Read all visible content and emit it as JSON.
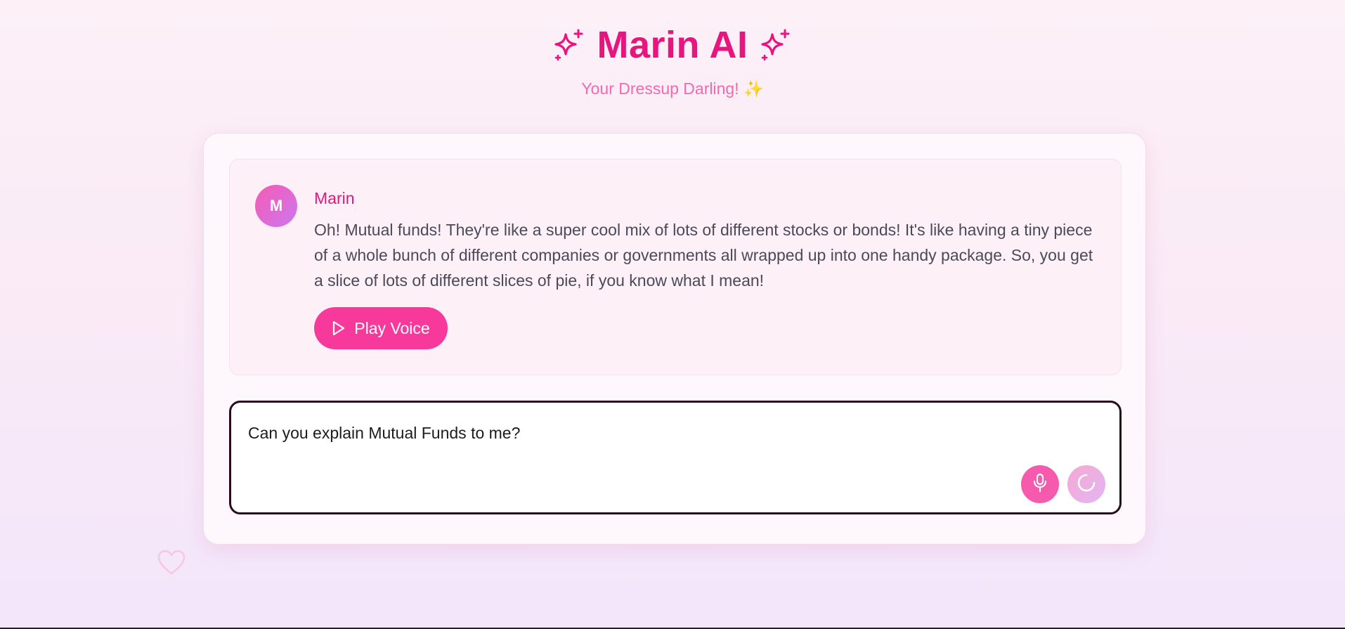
{
  "header": {
    "title": "Marin AI",
    "subtitle": "Your Dressup Darling! ✨",
    "sparkle_icon": "sparkle-icon"
  },
  "message": {
    "avatar_letter": "M",
    "sender": "Marin",
    "text": "Oh! Mutual funds! They're like a super cool mix of lots of different stocks or bonds! It's like having a tiny piece of a whole bunch of different companies or governments all wrapped up into one handy package. So, you get a slice of lots of different slices of pie, if you know what I mean!",
    "play_button_label": "Play Voice",
    "play_icon": "play-icon"
  },
  "input": {
    "value": "Can you explain Mutual Funds to me?",
    "mic_icon": "microphone-icon",
    "loading_icon": "loading-spinner-icon"
  },
  "decorations": {
    "heart_icon": "heart-icon"
  },
  "colors": {
    "accent": "#e8157f",
    "button": "#f7399c",
    "mic": "#f55aad",
    "subtitle": "#f06aae",
    "background": "#fdf0f7"
  }
}
